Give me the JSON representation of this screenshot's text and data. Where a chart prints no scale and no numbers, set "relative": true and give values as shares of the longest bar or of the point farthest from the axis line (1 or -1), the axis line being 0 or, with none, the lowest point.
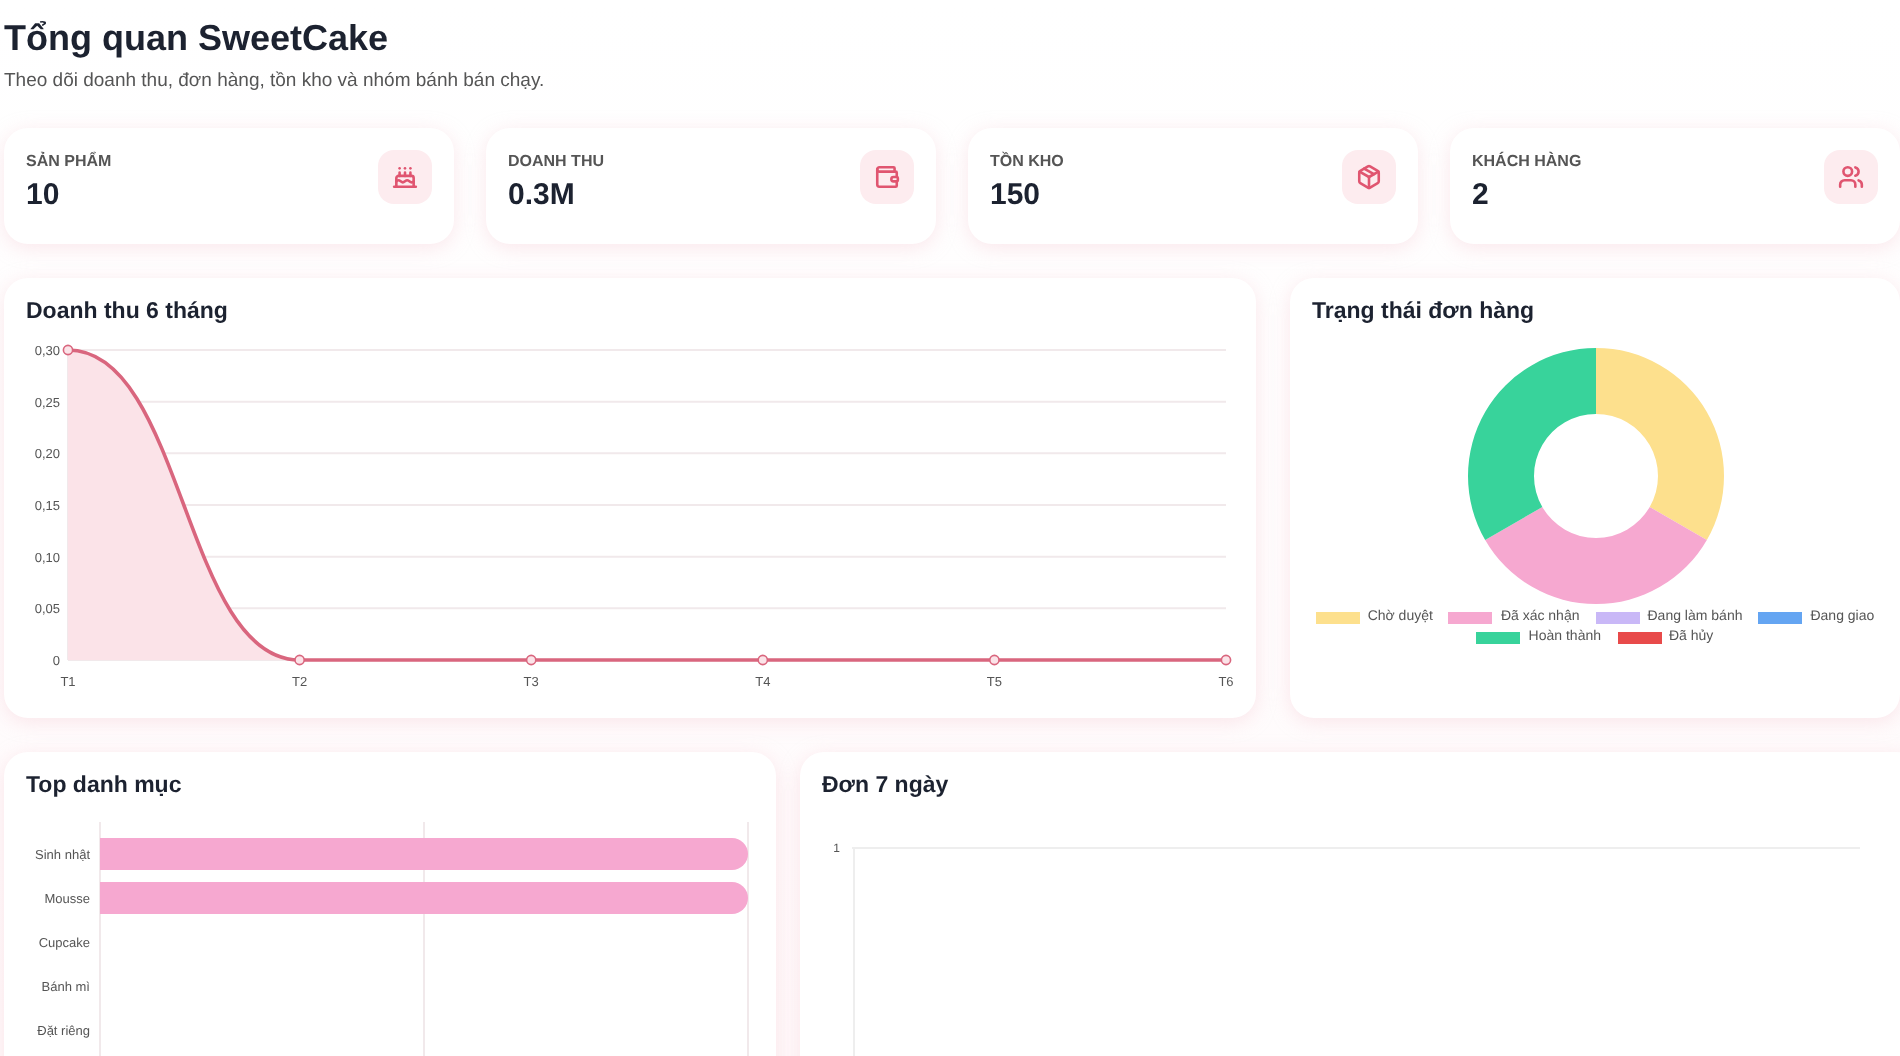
{
  "header": {
    "title": "Tổng quan SweetCake",
    "subtitle": "Theo dõi doanh thu, đơn hàng, tồn kho và nhóm bánh bán chạy."
  },
  "stats": [
    {
      "kind": "cake",
      "label": "SẢN PHẨM",
      "value": "10"
    },
    {
      "kind": "wallet",
      "label": "DOANH THU",
      "value": "0.3M"
    },
    {
      "kind": "box",
      "label": "TỒN KHO",
      "value": "150"
    },
    {
      "kind": "users",
      "label": "KHÁCH HÀNG",
      "value": "2"
    }
  ],
  "revenue_chart": {
    "title": "Doanh thu 6 tháng",
    "chart_data": {
      "type": "area",
      "categories": [
        "T1",
        "T2",
        "T3",
        "T4",
        "T5",
        "T6"
      ],
      "series": [
        {
          "color": "#d9667e",
          "values": [
            0.3,
            0,
            0,
            0,
            0,
            0
          ]
        }
      ],
      "ylim": [
        0,
        0.3
      ],
      "grid": true,
      "yticks": [
        {
          "value": 0,
          "label": "0"
        },
        {
          "value": 0.05,
          "label": "0,05"
        },
        {
          "value": 0.1,
          "label": "0,10"
        },
        {
          "value": 0.15,
          "label": "0,15"
        },
        {
          "value": 0.2,
          "label": "0,20"
        },
        {
          "value": 0.25,
          "label": "0,25"
        },
        {
          "value": 0.3,
          "label": "0,30"
        }
      ]
    }
  },
  "status_chart": {
    "title": "Trạng thái đơn hàng",
    "chart_data": {
      "type": "donut",
      "categories": [
        "Chờ duyệt",
        "Đã xác nhận",
        "Đang làm bánh",
        "Đang giao",
        "Hoàn thành",
        "Đã hủy"
      ],
      "series": [
        {
          "values": [
            33.33,
            33.33,
            0,
            0,
            33.34,
            0
          ]
        }
      ],
      "colors": [
        "#fde08d",
        "#f6a8d0",
        "#c9b8f7",
        "#64a5f2",
        "#38d39b",
        "#e84a4a"
      ]
    }
  },
  "category_chart": {
    "title": "Top danh mục",
    "chart_data": {
      "type": "bar",
      "orientation": "horizontal",
      "categories": [
        "Sinh nhật",
        "Mousse",
        "Cupcake",
        "Bánh mì",
        "Đặt riêng"
      ],
      "series": [
        {
          "color": "#f6a8d0",
          "values": [
            1,
            1,
            0,
            0,
            0
          ]
        }
      ],
      "relative": true,
      "ref_lines": [
        {
          "axis": "x",
          "value": 0.5
        }
      ]
    }
  },
  "orders_chart": {
    "title": "Đơn 7 ngày",
    "y_tick": "1"
  }
}
